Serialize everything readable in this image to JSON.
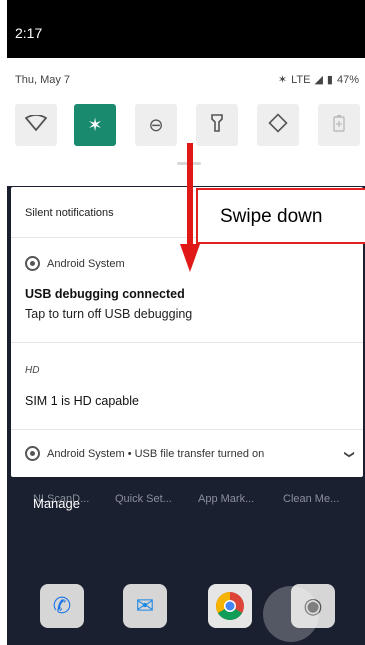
{
  "status_bar": {
    "time": "2:17"
  },
  "quick_settings": {
    "date": "Thu, May 7",
    "network": "LTE",
    "battery": "47%",
    "tiles": [
      {
        "name": "wifi",
        "icon": "wifi-icon",
        "active": false
      },
      {
        "name": "bluetooth",
        "icon": "bluetooth-icon",
        "active": true
      },
      {
        "name": "dnd",
        "icon": "dnd-icon",
        "active": false
      },
      {
        "name": "flashlight",
        "icon": "flashlight-icon",
        "active": false
      },
      {
        "name": "auto-rotate",
        "icon": "rotate-icon",
        "active": false
      },
      {
        "name": "battery-saver",
        "icon": "battery-saver-icon",
        "active": false
      }
    ]
  },
  "notifications": {
    "section_title": "Silent notifications",
    "usb": {
      "app": "Android System",
      "title": "USB debugging connected",
      "body": "Tap to turn off USB debugging"
    },
    "hd": {
      "label": "HD",
      "text": "SIM 1 is HD capable"
    },
    "collapsed": {
      "text": "Android System • USB file transfer turned on"
    }
  },
  "annotation": {
    "callout": "Swipe down"
  },
  "home": {
    "manage": "Manage",
    "app_labels": [
      "NLScanD...",
      "Quick Set...",
      "App Mark...",
      "Clean Me..."
    ]
  },
  "colors": {
    "accent": "#1a8a6f",
    "arrow": "#e01818"
  }
}
